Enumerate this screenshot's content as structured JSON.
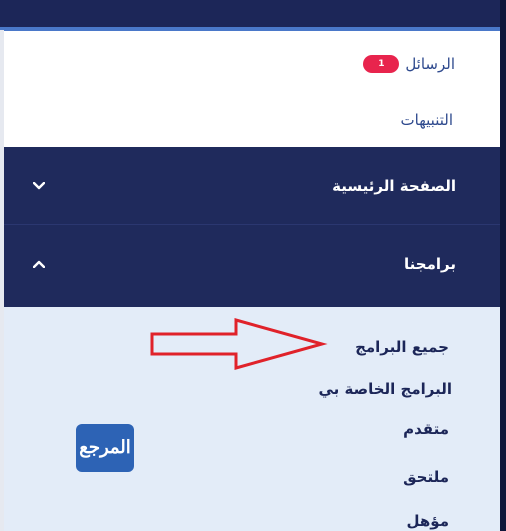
{
  "menu": {
    "messages_label": "الرسائل",
    "messages_badge": "1",
    "alerts_label": "التنبيهات",
    "home_label": "الصفحة الرئيسية",
    "programs_label": "برامجنا"
  },
  "programs_submenu": [
    {
      "label": "جميع البرامج"
    },
    {
      "label": "البرامج الخاصة بي"
    },
    {
      "label": "متقدم"
    },
    {
      "label": "ملتحق"
    },
    {
      "label": "مؤهل"
    }
  ],
  "watermark": {
    "text": "المرجع"
  },
  "icons": {
    "home_chevron": "chevron-down-icon",
    "programs_chevron": "chevron-up-icon",
    "annotation": "red-outline-arrow-icon"
  },
  "colors": {
    "nav_bg": "#1f2a5c",
    "badge": "#e8244d",
    "submenu_bg": "#e3ecf8",
    "accent_line": "#4a78c9",
    "arrow": "#e0222a",
    "logo_bg": "#2d63b5"
  }
}
